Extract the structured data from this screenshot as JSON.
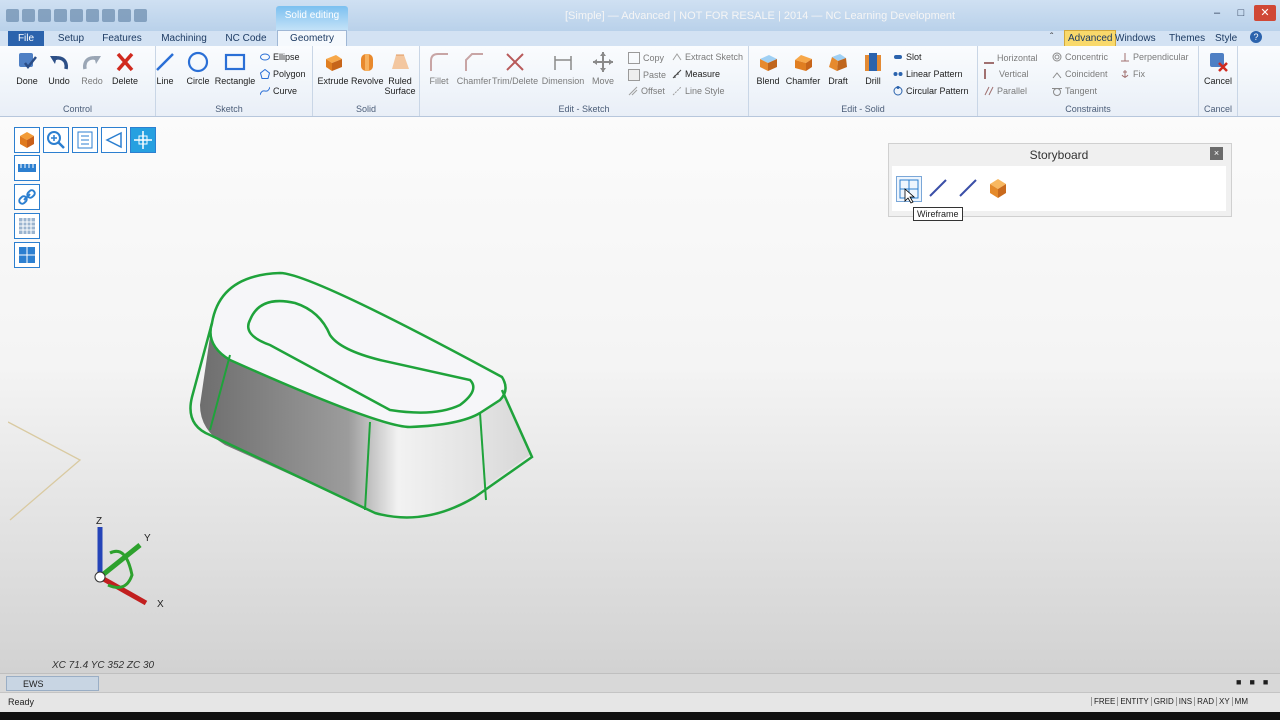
{
  "app": {
    "title": "[Simple] — Advanced | NOT FOR RESALE | 2014 — NC Learning Development",
    "contextual_tab": "Solid editing"
  },
  "tabs": [
    "File",
    "Setup",
    "Features",
    "Machining",
    "NC Code",
    "Geometry"
  ],
  "right_tabs": [
    "Advanced",
    "Windows",
    "Themes",
    "Style"
  ],
  "ribbon": {
    "control": {
      "label": "Control",
      "done": "Done",
      "undo": "Undo",
      "redo": "Redo",
      "delete": "Delete"
    },
    "sketch": {
      "label": "Sketch",
      "line": "Line",
      "circle": "Circle",
      "rectangle": "Rectangle",
      "ellipse": "Ellipse",
      "polygon": "Polygon",
      "curve": "Curve"
    },
    "solid": {
      "label": "Solid",
      "extrude": "Extrude",
      "revolve": "Revolve",
      "ruled_surface_1": "Ruled",
      "ruled_surface_2": "Surface"
    },
    "edit_sketch": {
      "label": "Edit - Sketch",
      "fillet": "Fillet",
      "chamfer": "Chamfer",
      "trim_delete": "Trim/Delete",
      "dimension": "Dimension",
      "move": "Move",
      "copy": "Copy",
      "paste": "Paste",
      "offset": "Offset",
      "extract_sketch": "Extract Sketch",
      "measure": "Measure",
      "line_style": "Line Style"
    },
    "edit_solid": {
      "label": "Edit - Solid",
      "blend": "Blend",
      "chamfer": "Chamfer",
      "draft": "Draft",
      "drill": "Drill",
      "slot": "Slot",
      "linear_pattern": "Linear Pattern",
      "circular_pattern": "Circular Pattern"
    },
    "constraints": {
      "label": "Constraints",
      "horizontal": "Horizontal",
      "vertical": "Vertical",
      "parallel": "Parallel",
      "concentric": "Concentric",
      "coincident": "Coincident",
      "tangent": "Tangent",
      "perpendicular": "Perpendicular",
      "fix": "Fix"
    },
    "cancel": {
      "label": "Cancel",
      "cancel": "Cancel"
    }
  },
  "storyboard": {
    "title": "Storyboard",
    "close": "×",
    "tooltip": "Wireframe"
  },
  "axes": {
    "x": "X",
    "y": "Y",
    "z": "Z"
  },
  "coords": "XC 71.4 YC 352 ZC 30",
  "bottom_tab": "EWS",
  "status": {
    "text": "Ready",
    "modes": [
      "FREE",
      "ENTITY",
      "GRID",
      "INS",
      "RAD",
      "XY",
      "MM"
    ]
  },
  "colors": {
    "accent": "#2b63ad",
    "model_edge": "#1fa33b",
    "advanced_tab": "#f9d96b",
    "close_red": "#d04836"
  }
}
